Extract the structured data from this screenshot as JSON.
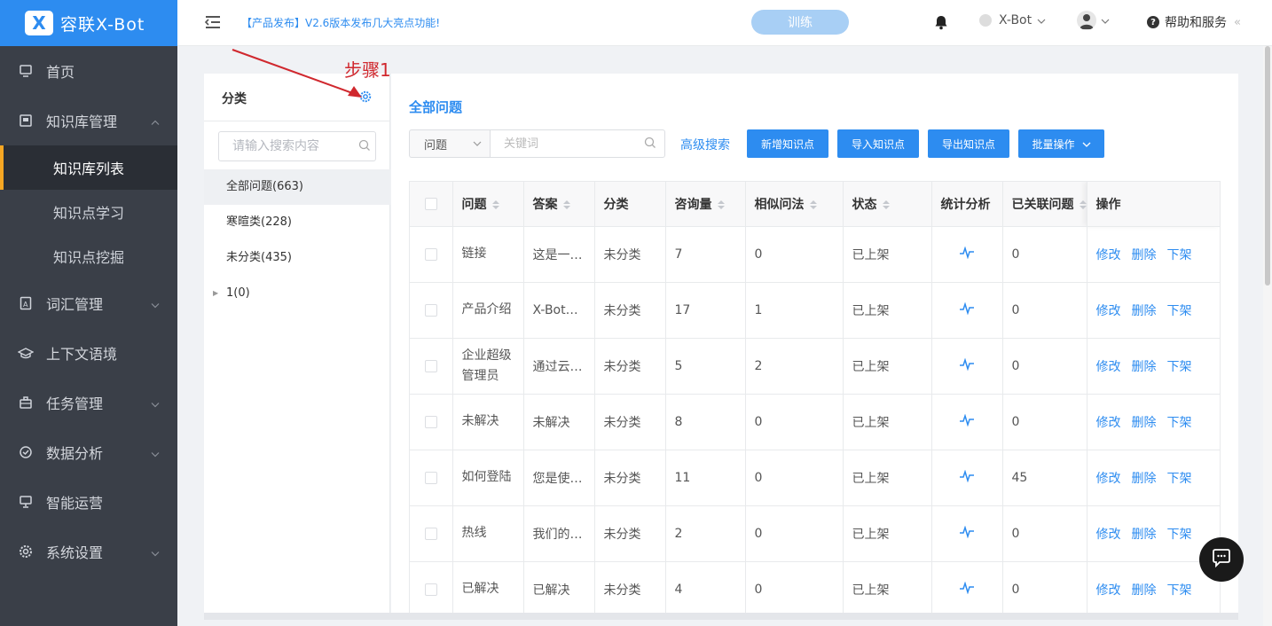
{
  "app": {
    "logo_mark": "X",
    "logo_text": "容联X-Bot"
  },
  "sidebar": {
    "items": [
      {
        "label": "首页",
        "icon": "monitor-icon"
      },
      {
        "label": "知识库管理",
        "icon": "book-icon",
        "expanded": true,
        "children": [
          {
            "label": "知识库列表",
            "active": true
          },
          {
            "label": "知识点学习"
          },
          {
            "label": "知识点挖掘"
          }
        ]
      },
      {
        "label": "词汇管理",
        "icon": "dictionary-icon"
      },
      {
        "label": "上下文语境",
        "icon": "graduation-cap-icon"
      },
      {
        "label": "任务管理",
        "icon": "briefcase-icon"
      },
      {
        "label": "数据分析",
        "icon": "gauge-icon"
      },
      {
        "label": "智能运营",
        "icon": "presentation-icon"
      },
      {
        "label": "系统设置",
        "icon": "gear-icon"
      }
    ]
  },
  "header": {
    "notice": "【产品发布】V2.6版本发布几大亮点功能!",
    "train_label": "训练",
    "bot_name": "X-Bot",
    "help_label": "帮助和服务",
    "collapse_glyph": "«"
  },
  "category": {
    "title": "分类",
    "search_placeholder": "请输入搜索内容",
    "items": [
      {
        "label": "全部问题(663)",
        "active": true
      },
      {
        "label": "寒暄类(228)"
      },
      {
        "label": "未分类(435)"
      },
      {
        "label": "1(0)",
        "collapsible": true
      }
    ]
  },
  "annotation": {
    "label": "步骤1",
    "color": "#d0282e"
  },
  "main": {
    "title": "全部问题",
    "filter_select": "问题",
    "keyword_placeholder": "关键词",
    "advanced_search": "高级搜索",
    "buttons": {
      "add": "新增知识点",
      "import": "导入知识点",
      "export": "导出知识点",
      "batch": "批量操作"
    }
  },
  "table": {
    "headers": {
      "question": "问题",
      "answer": "答案",
      "category": "分类",
      "count": "咨询量",
      "similar": "相似问法",
      "status": "状态",
      "stats": "统计分析",
      "linked": "已关联问题",
      "ops": "操作"
    },
    "action_labels": {
      "edit": "修改",
      "delete": "删除",
      "off_shelf": "下架"
    },
    "rows": [
      {
        "question": "链接",
        "answer": "这是一…",
        "category": "未分类",
        "count": "7",
        "similar": "0",
        "status": "已上架",
        "linked": "0"
      },
      {
        "question": "产品介绍",
        "answer": "X-Bot…",
        "category": "未分类",
        "count": "17",
        "similar": "1",
        "status": "已上架",
        "linked": "0"
      },
      {
        "question": "企业超级管理员",
        "answer": "通过云…",
        "category": "未分类",
        "count": "5",
        "similar": "2",
        "status": "已上架",
        "linked": "0"
      },
      {
        "question": "未解决",
        "answer": "未解决",
        "category": "未分类",
        "count": "8",
        "similar": "0",
        "status": "已上架",
        "linked": "0"
      },
      {
        "question": "如何登陆",
        "answer": "您是使…",
        "category": "未分类",
        "count": "11",
        "similar": "0",
        "status": "已上架",
        "linked": "45"
      },
      {
        "question": "热线",
        "answer": "我们的…",
        "category": "未分类",
        "count": "2",
        "similar": "0",
        "status": "已上架",
        "linked": "0"
      },
      {
        "question": "已解决",
        "answer": "已解决",
        "category": "未分类",
        "count": "4",
        "similar": "0",
        "status": "已上架",
        "linked": "0"
      }
    ]
  },
  "colors": {
    "primary": "#2d8cf0",
    "sidebar_bg": "#3a3f48",
    "active_indicator": "#f5a623"
  }
}
